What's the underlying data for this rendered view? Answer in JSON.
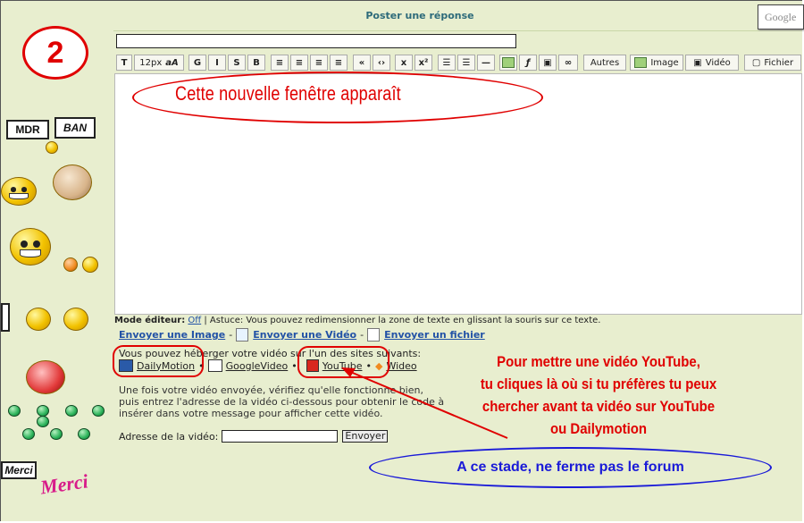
{
  "header": {
    "title": "Poster une réponse",
    "search_logo": "Google"
  },
  "sidebar": {
    "step_number": "2",
    "sign_mdr": "MDR",
    "sign_ban": "BAN",
    "sign_merci": "Merci",
    "merci_logo": "Merci"
  },
  "toolbar": {
    "font_size": "12px",
    "font_case": "aA",
    "bold": "G",
    "italic": "I",
    "strike": "S",
    "b_extra": "B",
    "quote": "«",
    "code": "‹›",
    "subscript": "x",
    "superscript": "x²",
    "others": "Autres",
    "image": "Image",
    "video": "Vidéo",
    "file": "Fichier"
  },
  "annotations": {
    "new_window": "Cette nouvelle fenêtre apparaît",
    "youtube_instructions": [
      "Pour mettre une vidéo YouTube,",
      "tu cliques là où si tu préfères tu peux",
      "chercher avant ta vidéo sur YouTube",
      "ou Dailymotion"
    ],
    "keep_forum_open": "A ce stade, ne ferme pas le forum"
  },
  "editor_mode": {
    "label": "Mode éditeur:",
    "value": "Off",
    "tip": " | Astuce: Vous pouvez redimensionner la zone de texte en glissant la souris sur ce texte."
  },
  "upload_links": {
    "image": "Envoyer une Image",
    "video": "Envoyer une Vidéo",
    "file": "Envoyer un fichier",
    "sep": "-"
  },
  "hosts": {
    "intro": "Vous pouvez héberger votre vidéo sur l'un des sites suivants:",
    "items": [
      "DailyMotion",
      "GoogleVideo",
      "YouTube",
      "Wideo"
    ],
    "sep": "•"
  },
  "instructions": [
    "Une fois votre vidéo envoyée, vérifiez qu'elle fonctionne bien,",
    "puis entrez l'adresse de la vidéo ci-dessous pour obtenir le code à",
    "insérer dans votre message pour afficher cette vidéo."
  ],
  "address": {
    "label": "Adresse de la vidéo:",
    "value": "",
    "submit": "Envoyer"
  },
  "colors": {
    "panel": "#e8eecf",
    "accent_red": "#e00000",
    "accent_blue": "#1a1ad8",
    "link": "#2252a6"
  }
}
